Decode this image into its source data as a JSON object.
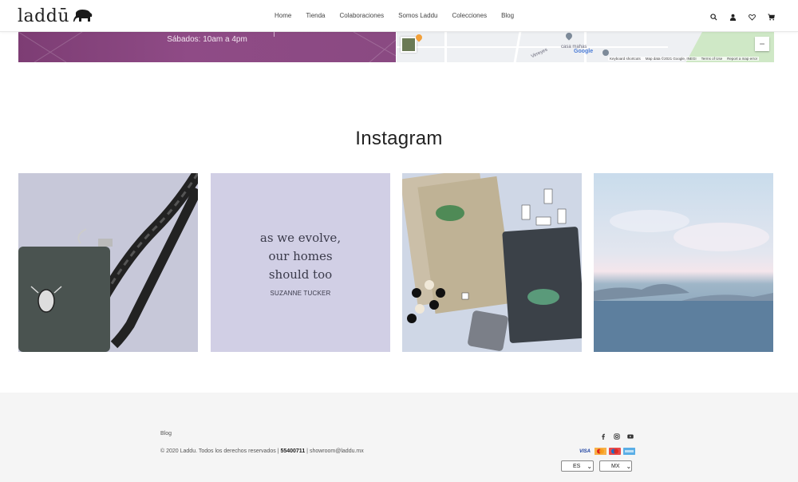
{
  "brand": {
    "name": "laddū"
  },
  "nav": {
    "items": [
      "Home",
      "Tienda",
      "Colaboraciones",
      "Somos Laddu",
      "Colecciones",
      "Blog"
    ]
  },
  "header_icons": [
    "search-icon",
    "user-icon",
    "heart-icon",
    "cart-icon"
  ],
  "store": {
    "hours": "Sábados: 10am a 4pm"
  },
  "map": {
    "labels": [
      "casa mahas",
      "Virreyes"
    ],
    "credits": [
      "Keyboard shortcuts",
      "Map data ©2021 Google, INEGI",
      "Terms of Use",
      "Report a map error"
    ],
    "zoom_out": "−",
    "google": "Google"
  },
  "instagram": {
    "title": "Instagram",
    "quote_lines": [
      "as we evolve,",
      "our homes",
      "should too"
    ],
    "quote_author": "SUZANNE TUCKER"
  },
  "footer": {
    "blog": "Blog",
    "copyright": "© 2020 Laddu. Todos los derechos reservados |",
    "phone": "55400711",
    "email_sep": "|",
    "email": "showroom@laddu.mx",
    "social": [
      "facebook-icon",
      "instagram-icon",
      "youtube-icon"
    ],
    "cards": [
      "VISA",
      "MC",
      "MAESTRO",
      "AMEX"
    ],
    "language": "ES",
    "currency": "MX"
  },
  "colors": {
    "purple_band": "#8a4a82",
    "footer_bg": "#f5f5f5"
  }
}
